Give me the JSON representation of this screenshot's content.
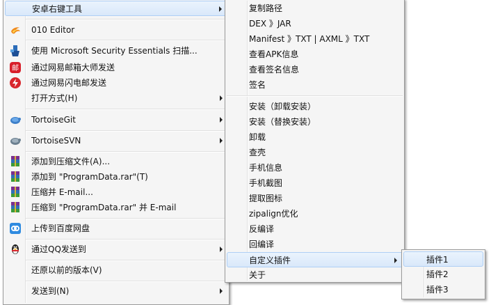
{
  "main_menu": {
    "items": [
      {
        "label": "安卓右键工具",
        "submenu": true,
        "icon": null
      },
      {
        "label": "010 Editor",
        "submenu": false,
        "icon": "flame-icon"
      },
      {
        "label": "使用 Microsoft Security Essentials 扫描...",
        "submenu": false,
        "icon": "security-essentials-icon"
      },
      {
        "label": "通过网易邮箱大师发送",
        "submenu": false,
        "icon": "netease-mail-master-icon"
      },
      {
        "label": "通过网易闪电邮发送",
        "submenu": false,
        "icon": "netease-flash-mail-icon"
      },
      {
        "label": "打开方式(H)",
        "submenu": true,
        "icon": null
      },
      {
        "label": "TortoiseGit",
        "submenu": true,
        "icon": "tortoisegit-icon"
      },
      {
        "label": "TortoiseSVN",
        "submenu": true,
        "icon": "tortoisesvn-icon"
      },
      {
        "label": "添加到压缩文件(A)...",
        "submenu": false,
        "icon": "winrar-icon"
      },
      {
        "label": "添加到 \"ProgramData.rar\"(T)",
        "submenu": false,
        "icon": "winrar-icon"
      },
      {
        "label": "压缩并 E-mail...",
        "submenu": false,
        "icon": "winrar-icon"
      },
      {
        "label": "压缩到 \"ProgramData.rar\" 并 E-mail",
        "submenu": false,
        "icon": "winrar-icon"
      },
      {
        "label": "上传到百度网盘",
        "submenu": false,
        "icon": "baidu-netdisk-icon"
      },
      {
        "label": "通过QQ发送到",
        "submenu": true,
        "icon": "qq-penguin-icon"
      },
      {
        "label": "还原以前的版本(V)",
        "submenu": false,
        "icon": null
      },
      {
        "label": "发送到(N)",
        "submenu": true,
        "icon": null
      }
    ]
  },
  "tools_submenu": {
    "items": [
      {
        "label": "复制路径"
      },
      {
        "label": "DEX 》JAR"
      },
      {
        "label": "Manifest 》TXT | AXML 》TXT"
      },
      {
        "label": "查看APK信息"
      },
      {
        "label": "查看签名信息"
      },
      {
        "label": "签名"
      },
      {
        "label": "安装（卸载安装）"
      },
      {
        "label": "安装（替换安装）"
      },
      {
        "label": "卸载"
      },
      {
        "label": "查壳"
      },
      {
        "label": "手机信息"
      },
      {
        "label": "手机截图"
      },
      {
        "label": "提取图标"
      },
      {
        "label": "zipalign优化"
      },
      {
        "label": "反编译"
      },
      {
        "label": "回编译"
      },
      {
        "label": "自定义插件",
        "submenu": true
      },
      {
        "label": "关于"
      }
    ]
  },
  "plugin_submenu": {
    "items": [
      {
        "label": "插件1"
      },
      {
        "label": "插件2"
      },
      {
        "label": "插件3"
      }
    ]
  },
  "colors": {
    "menu_bg": "#f5f5f5",
    "highlight_bg": "#d9e8fa",
    "highlight_border": "#aecff5"
  }
}
